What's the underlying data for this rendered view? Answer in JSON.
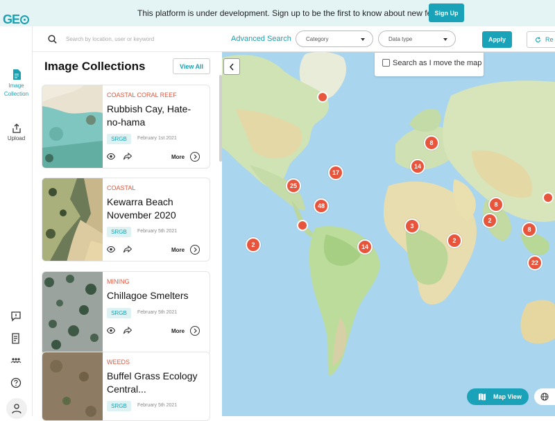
{
  "app": {
    "logo_text": "GE"
  },
  "banner": {
    "message": "This platform is under development. Sign up to be the first to know about new features.",
    "signup_label": "Sign Up"
  },
  "rail": [
    {
      "label": "Image\nCollection",
      "icon": "document-icon",
      "active": true
    },
    {
      "label": "Upload",
      "icon": "upload-icon",
      "active": false
    }
  ],
  "search": {
    "placeholder": "Search by location, user or keyword"
  },
  "panel": {
    "title": "Image Collections",
    "view_all": "View All"
  },
  "cards": [
    {
      "category": "COASTAL CORAL REEF",
      "title": "Rubbish Cay, Hate-no-hama",
      "tag": "SRGB",
      "date": "February 1st 2021",
      "more": "More"
    },
    {
      "category": "COASTAL",
      "title": "Kewarra Beach November 2020",
      "tag": "SRGB",
      "date": "February 5th 2021",
      "more": "More"
    },
    {
      "category": "MINING",
      "title": "Chillagoe Smelters",
      "tag": "SRGB",
      "date": "February 5th 2021",
      "more": "More"
    },
    {
      "category": "WEEDS",
      "title": "Buffel Grass Ecology Central...",
      "tag": "SRGB",
      "date": "February 5th 2021",
      "more": "More"
    }
  ],
  "toolbar": {
    "advanced_search": "Advanced Search",
    "category_placeholder": "Category",
    "data_type_placeholder": "Data type",
    "apply": "Apply",
    "reset": "Re"
  },
  "map": {
    "search_as_move": "Search as I move the map",
    "clusters": [
      "8",
      "14",
      "17",
      "25",
      "48",
      "3",
      "14",
      "2",
      "8",
      "2",
      "8",
      "2",
      "22"
    ],
    "map_view_label": "Map View"
  },
  "colors": {
    "accent": "#1aa3b8",
    "cluster": "#e8553d",
    "category": "#e3573e",
    "ocean": "#a9d5ee"
  }
}
